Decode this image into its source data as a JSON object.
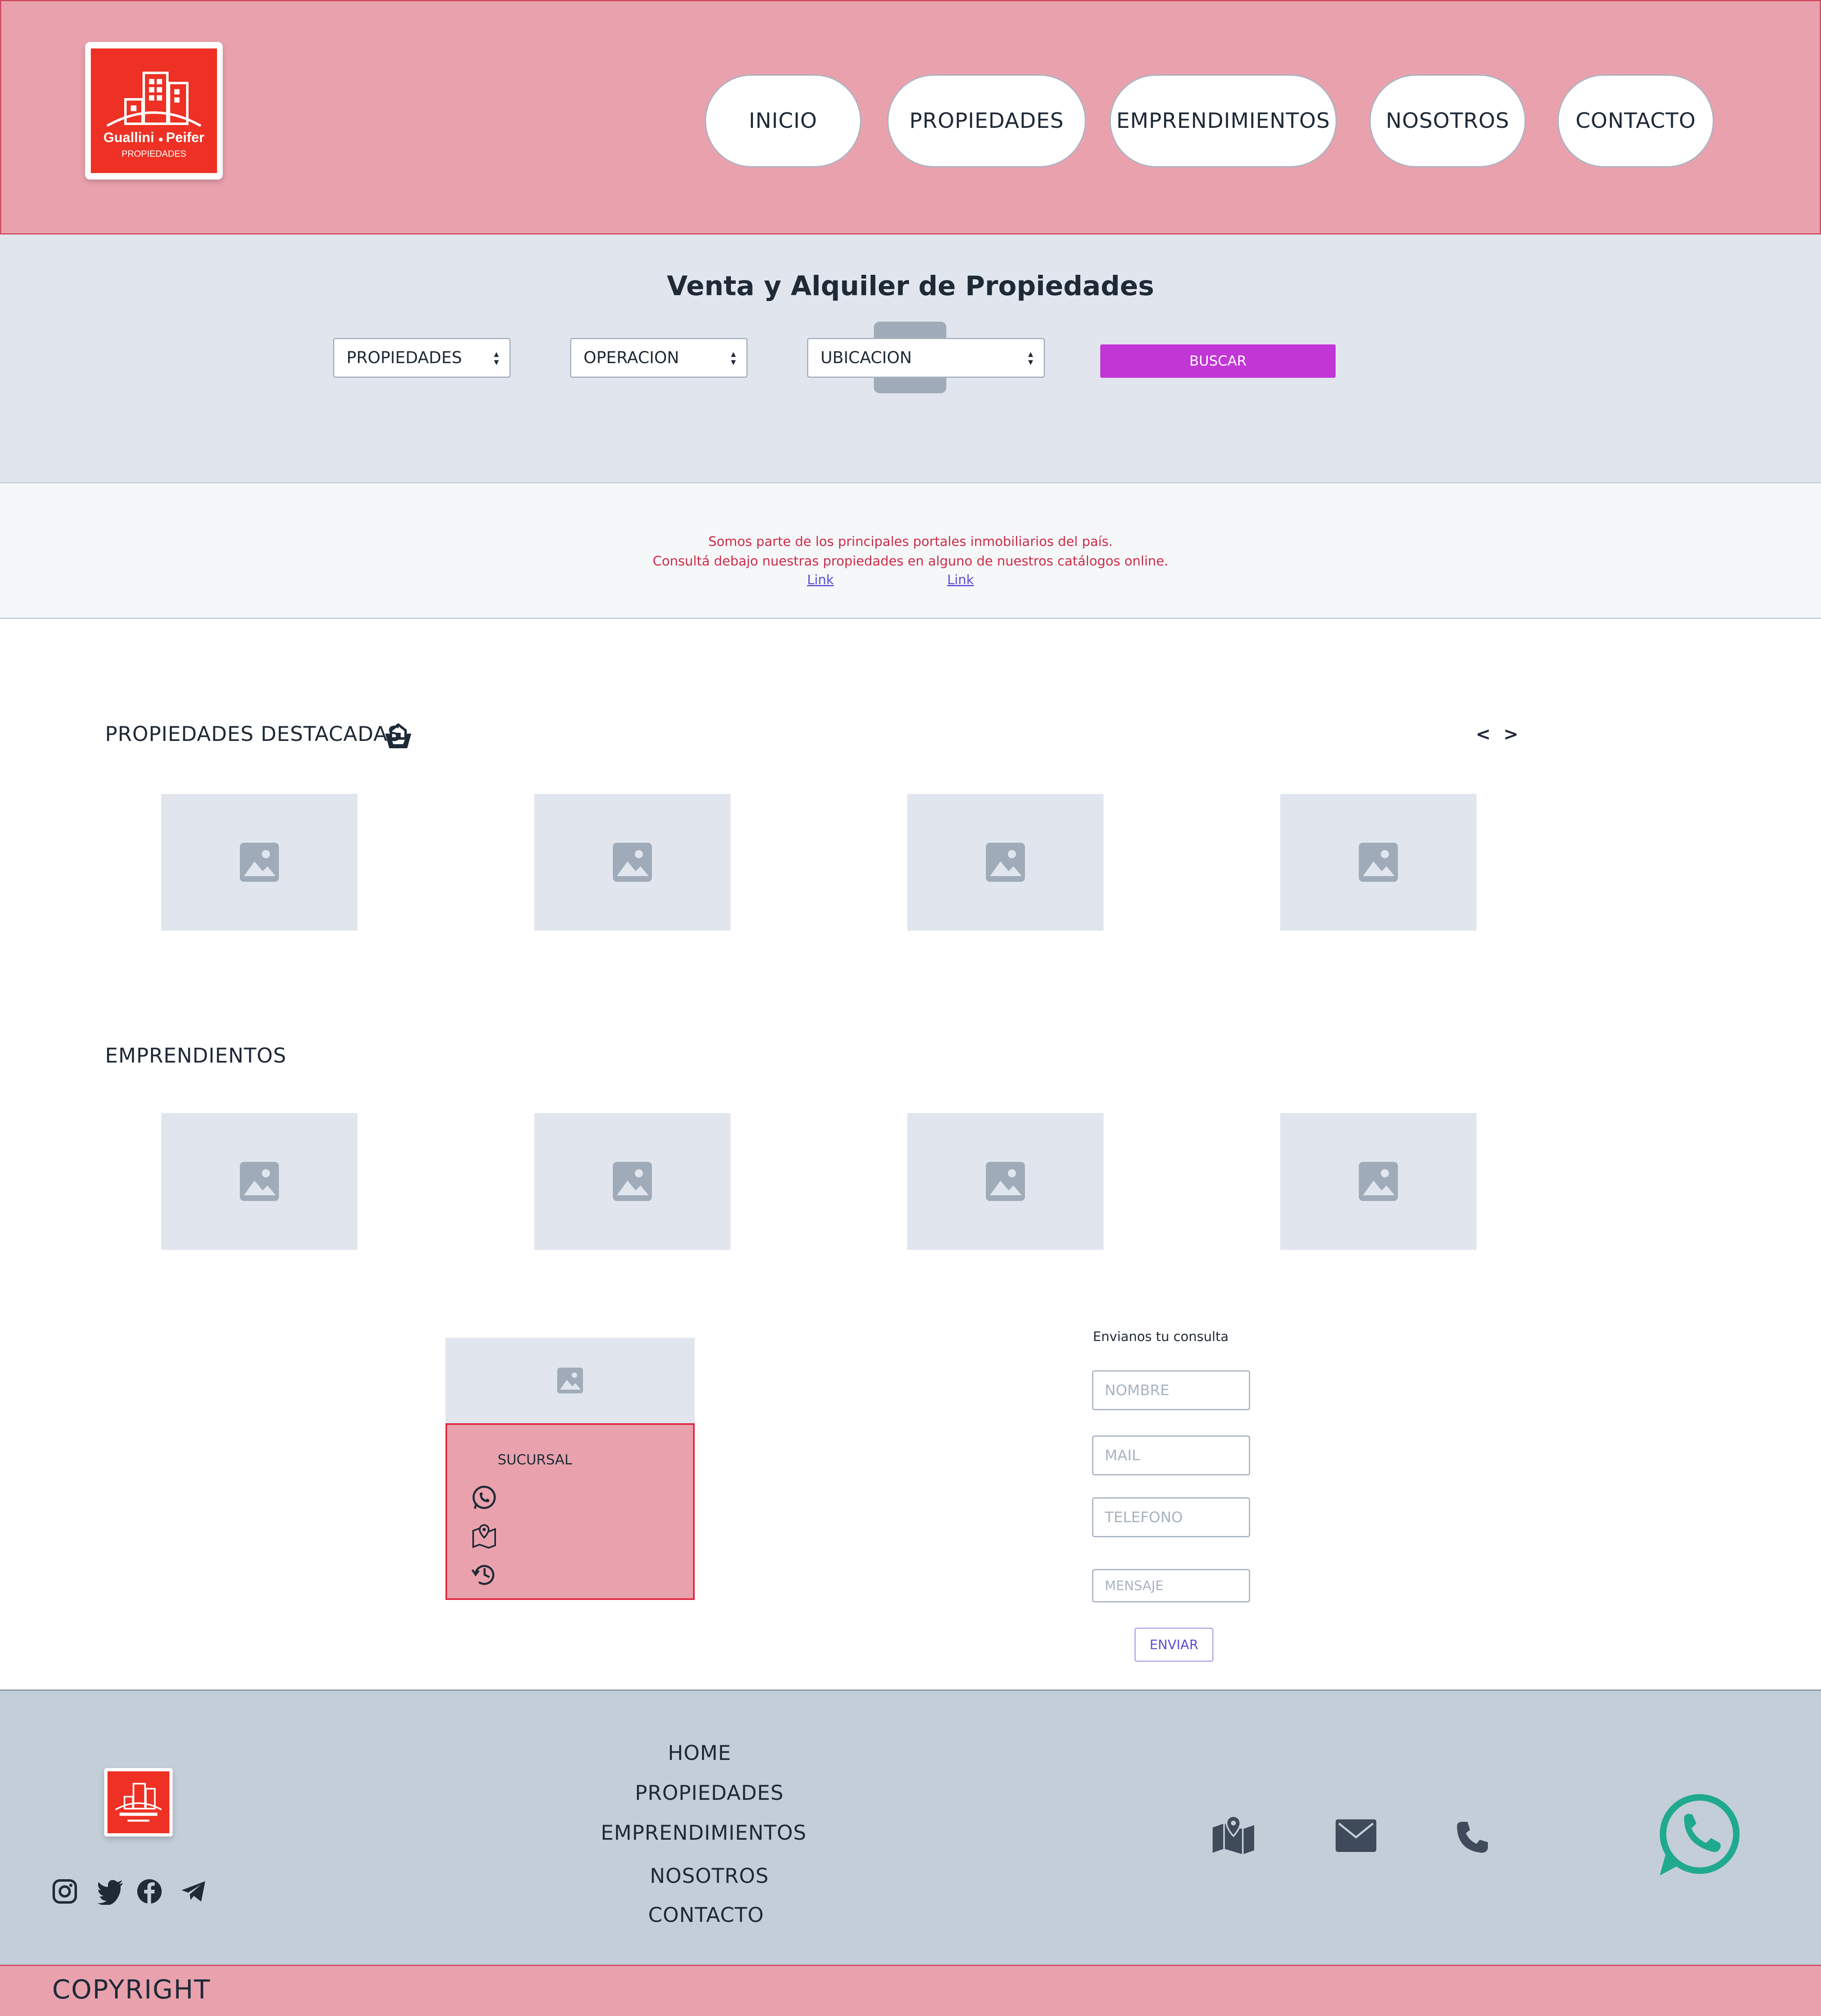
{
  "header": {
    "logo": {
      "line1": "Guallini",
      "line2": "Peifer",
      "sub": "PROPIEDADES"
    },
    "nav": [
      "INICIO",
      "PROPIEDADES",
      "EMPRENDIMIENTOS",
      "NOSOTROS",
      "CONTACTO"
    ]
  },
  "search": {
    "title": "Venta y Alquiler de Propiedades",
    "selects": [
      "PROPIEDADES",
      "OPERACION",
      "UBICACION"
    ],
    "button": "BUSCAR"
  },
  "portals": {
    "line1": "Somos parte de los principales portales inmobiliarios del país.",
    "line2": "Consultá debajo nuestras propiedades en alguno de nuestros catálogos online.",
    "links": [
      "Link",
      "Link"
    ]
  },
  "featured": {
    "title": "PROPIEDADES DESTACADAS",
    "prev": "<",
    "next": ">"
  },
  "emprendimientos": {
    "title": "EMPRENDIENTOS"
  },
  "branch": {
    "label": "SUCURSAL"
  },
  "contact_form": {
    "title": "Envianos tu consulta",
    "fields": [
      "NOMBRE",
      "MAIL",
      "TELEFONO",
      "MENSAJE"
    ],
    "submit": "ENVIAR"
  },
  "footer": {
    "links": [
      "HOME",
      "PROPIEDADES",
      "EMPRENDIMIENTOS",
      "NOSOTROS",
      "CONTACTO"
    ],
    "copyright": "COPYRIGHT"
  },
  "colors": {
    "header_bg": "#e9a2ad",
    "accent_button": "#c236d6",
    "logo_red": "#ee3124",
    "whatsapp": "#1fa98e"
  }
}
